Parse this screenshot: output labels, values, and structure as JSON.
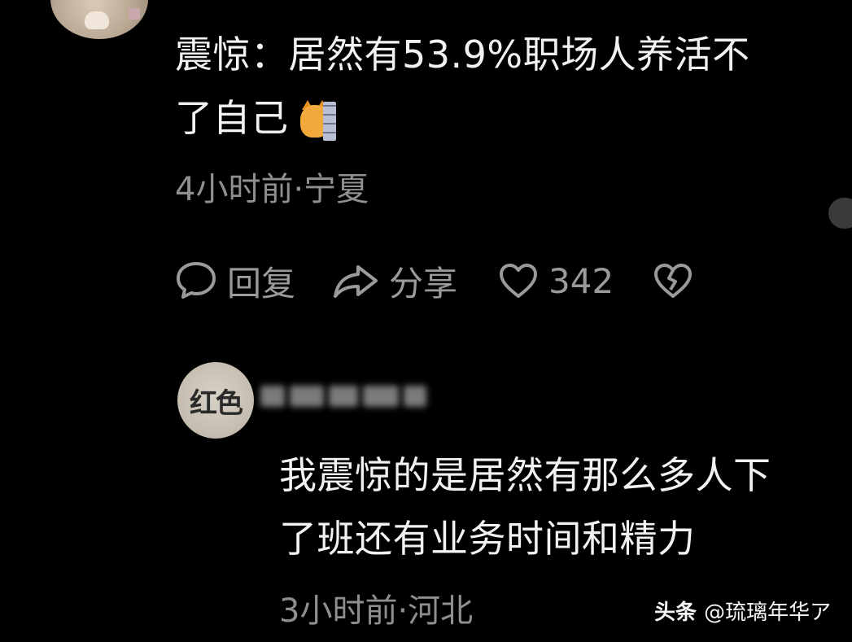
{
  "comment": {
    "text_line1": "震惊：居然有53.9%职场人养活不",
    "text_line2": "了自己",
    "emoji": "cat-peeking-behind-wall",
    "meta": "4小时前·宁夏"
  },
  "actions": {
    "reply_label": "回复",
    "share_label": "分享",
    "like_count": "342"
  },
  "reply": {
    "avatar_text": "红色",
    "text_line1": "我震惊的是居然有那么多人下",
    "text_line2": "了班还有业务时间和精力",
    "meta": "3小时前·河北"
  },
  "watermark": {
    "brand": "头条",
    "user": "@琉璃年华ア"
  },
  "colors": {
    "background": "#000000",
    "primary_text": "#f2f2f2",
    "secondary_text": "#8f8f8f"
  }
}
